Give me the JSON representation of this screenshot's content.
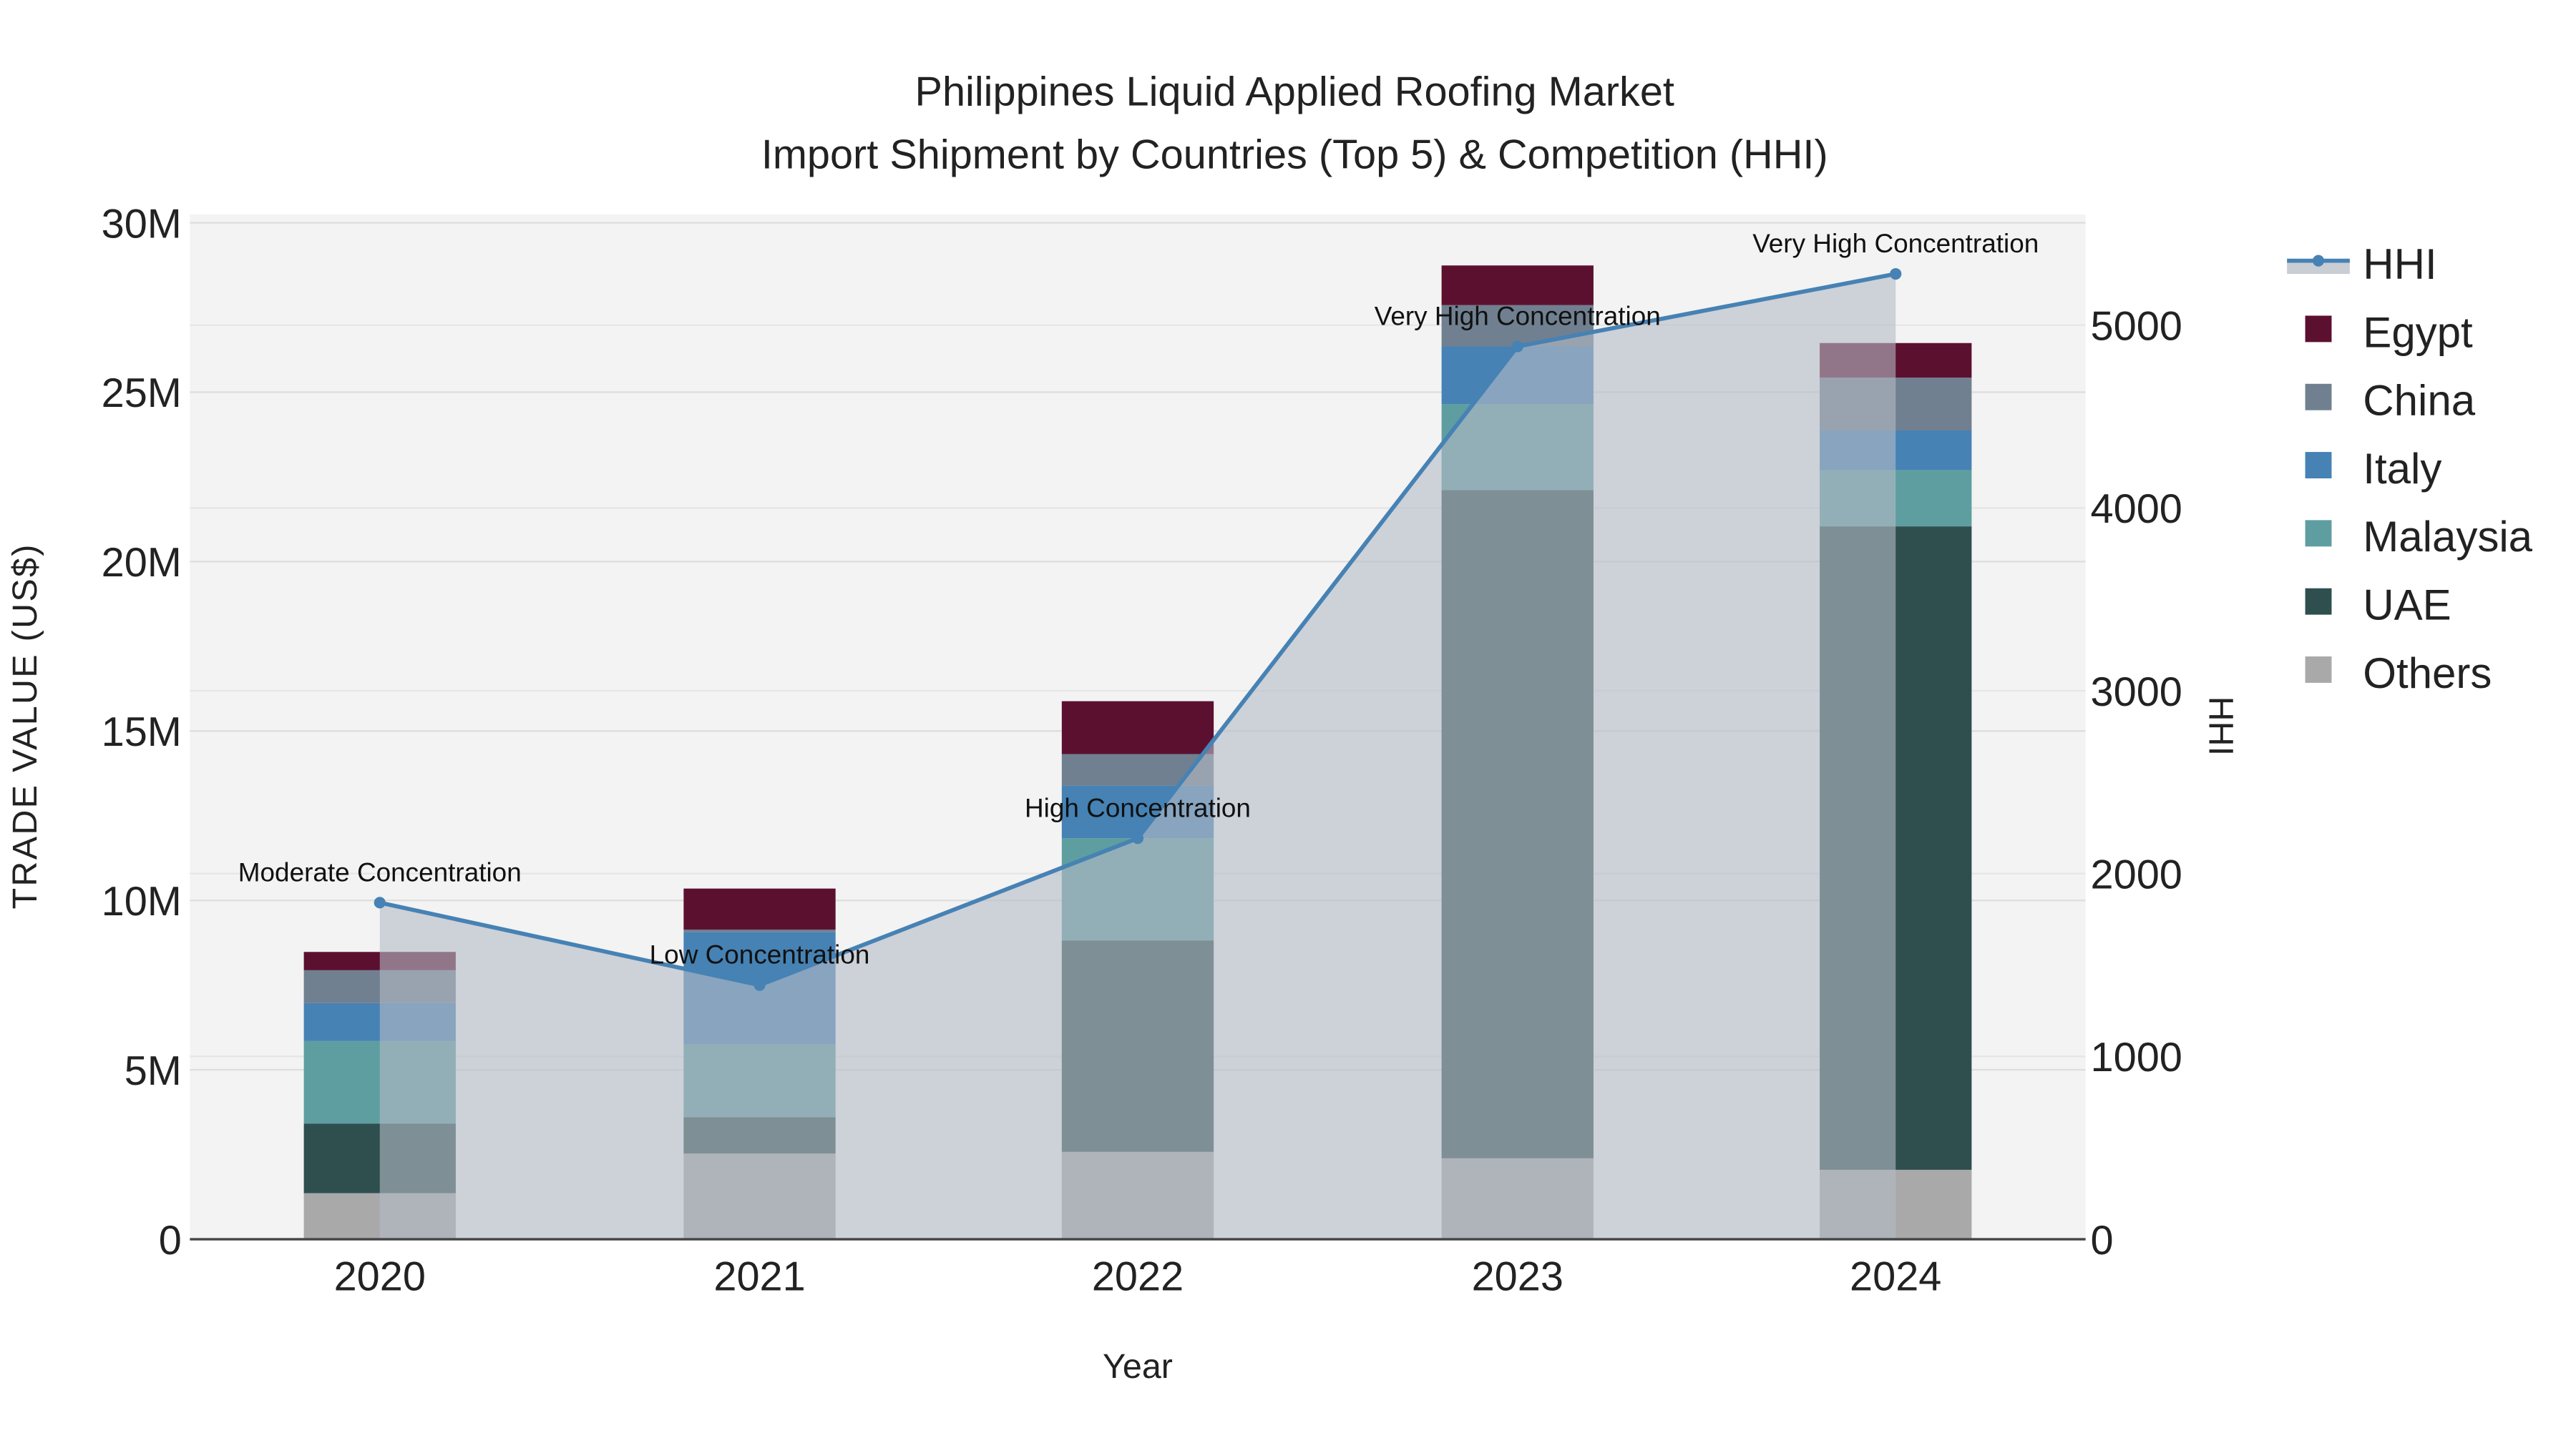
{
  "chart_data": {
    "type": "bar",
    "title": "Philippines Liquid Applied Roofing Market",
    "subtitle": "Import Shipment by Countries (Top 5) & Competition (HHI)",
    "xlabel": "Year",
    "ylabel": "TRADE VALUE (US$)",
    "y2label": "HHI",
    "categories": [
      "2020",
      "2021",
      "2022",
      "2023",
      "2024"
    ],
    "ylim": [
      0,
      30000000
    ],
    "y2lim": [
      0,
      5600
    ],
    "yticks": [
      {
        "v": 0,
        "label": "0"
      },
      {
        "v": 5000000,
        "label": "5M"
      },
      {
        "v": 10000000,
        "label": "10M"
      },
      {
        "v": 15000000,
        "label": "15M"
      },
      {
        "v": 20000000,
        "label": "20M"
      },
      {
        "v": 25000000,
        "label": "25M"
      },
      {
        "v": 30000000,
        "label": "30M"
      }
    ],
    "y2ticks": [
      {
        "v": 0,
        "label": "0"
      },
      {
        "v": 1000,
        "label": "1000"
      },
      {
        "v": 2000,
        "label": "2000"
      },
      {
        "v": 3000,
        "label": "3000"
      },
      {
        "v": 4000,
        "label": "4000"
      },
      {
        "v": 5000,
        "label": "5000"
      }
    ],
    "series": [
      {
        "name": "Others",
        "color": "#a9a9a9",
        "values": [
          1360000,
          2530000,
          2580000,
          2390000,
          2050000
        ]
      },
      {
        "name": "UAE",
        "color": "#2f4f4f",
        "values": [
          2050000,
          1070000,
          6240000,
          19720000,
          18990000
        ]
      },
      {
        "name": "Malaysia",
        "color": "#5f9ea0",
        "values": [
          2440000,
          2150000,
          3020000,
          2540000,
          1660000
        ]
      },
      {
        "name": "Italy",
        "color": "#4682b4",
        "values": [
          1120000,
          3310000,
          1550000,
          1700000,
          1170000
        ]
      },
      {
        "name": "China",
        "color": "#708090",
        "values": [
          970000,
          80000,
          930000,
          1220000,
          1560000
        ]
      },
      {
        "name": "Egypt",
        "color": "#5c1030",
        "values": [
          540000,
          1210000,
          1560000,
          1170000,
          1020000
        ]
      }
    ],
    "hhi": {
      "name": "HHI",
      "color": "#4682b4",
      "values": [
        1841,
        1390,
        2193,
        4883,
        5280
      ],
      "annotations": [
        "Moderate Concentration",
        "Low Concentration",
        "High Concentration",
        "Very High Concentration",
        "Very High Concentration"
      ]
    },
    "legend_order": [
      "HHI",
      "Egypt",
      "China",
      "Italy",
      "Malaysia",
      "UAE",
      "Others"
    ],
    "legend_position": "right"
  }
}
